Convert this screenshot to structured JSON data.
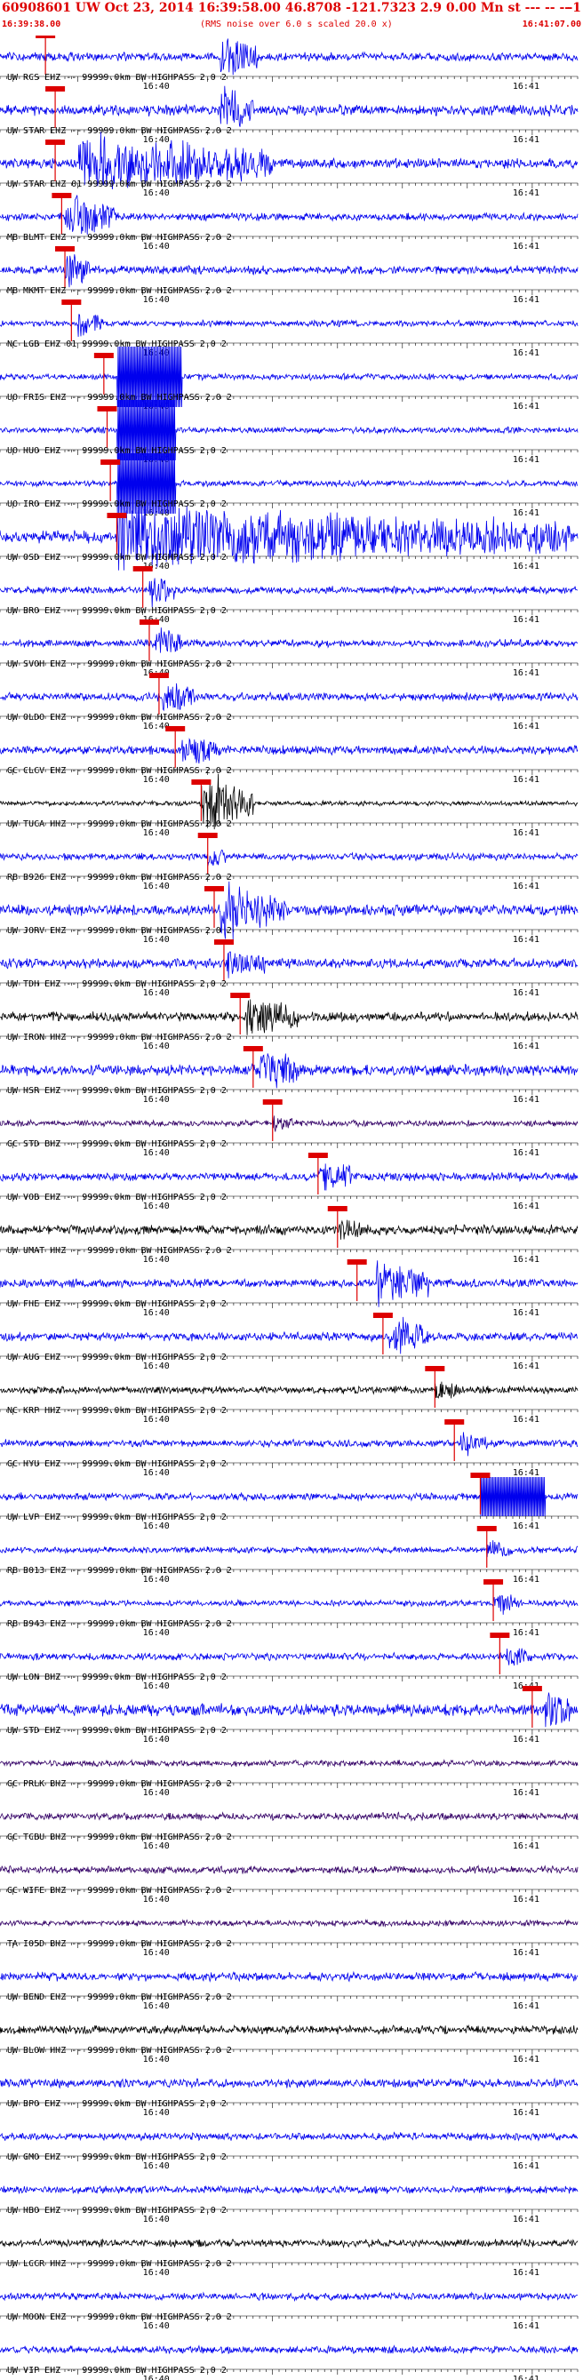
{
  "header": {
    "title": "60908601 UW Oct 23, 2014 16:39:58.00   46.8708 -121.7323  2.9 0.00 Mn st --- -- --",
    "title_tail": "-1",
    "start_time": "16:39:38.00",
    "end_time": "16:41:07.00",
    "note": "(RMS noise over 6.0 s scaled 20.0 x)"
  },
  "chart_data": {
    "type": "line",
    "title": "60908601 UW Oct 23, 2014 16:39:58.00   46.8708 -121.7323  2.9 0.00 Mn st --- -- --",
    "xlabel": "",
    "ylabel": "",
    "time_window": [
      "16:39:38.00",
      "16:41:07.00"
    ],
    "x_unit": "seconds after 16:39:38.00",
    "xlim": [
      0,
      89
    ],
    "minute_ticks": [
      {
        "t": 22,
        "label": "16:40"
      },
      {
        "t": 82,
        "label": "16:41"
      }
    ],
    "trace_label_suffix": " 99999.0km BW  HIGHPASS  2.0  2",
    "grid": false,
    "colors": {
      "header": "#dd0000",
      "pick": "#dd0000",
      "blue": "#0000ee",
      "black": "#000000",
      "purple": "#330066"
    },
    "series": [
      {
        "name": "UW RCS EHZ --",
        "color": "blue",
        "amp": 0.35,
        "pick": 7,
        "burst": [
          34,
          6,
          1.6
        ],
        "style": "normal"
      },
      {
        "name": "UW STAR EHZ --",
        "color": "blue",
        "amp": 0.45,
        "pick": 8.5,
        "burst": [
          34,
          5,
          1.6
        ],
        "style": "normal"
      },
      {
        "name": "UW STAR EHZ 01",
        "color": "blue",
        "amp": 0.4,
        "pick": 8.5,
        "burst": [
          12,
          30,
          2.2
        ],
        "style": "normal"
      },
      {
        "name": "MB BLMT EHZ --",
        "color": "blue",
        "amp": 0.3,
        "pick": 9.5,
        "burst": [
          10,
          8,
          1.8
        ],
        "style": "normal"
      },
      {
        "name": "MB MKMT EHZ --",
        "color": "blue",
        "amp": 0.35,
        "pick": 10,
        "burst": [
          10,
          4,
          1.4
        ],
        "style": "normal"
      },
      {
        "name": "NC LGB EHZ 01",
        "color": "blue",
        "amp": 0.25,
        "pick": 11,
        "burst": [
          12,
          4,
          1.0
        ],
        "style": "normal"
      },
      {
        "name": "UO FRIS EHZ --",
        "color": "blue",
        "amp": 0.25,
        "pick": 16,
        "burst": [
          18,
          10,
          3.5
        ],
        "style": "saturated"
      },
      {
        "name": "UO HUO EHZ --",
        "color": "blue",
        "amp": 0.25,
        "pick": 16.5,
        "burst": [
          18,
          9,
          3.5
        ],
        "style": "saturated"
      },
      {
        "name": "UO IRO EHZ --",
        "color": "blue",
        "amp": 0.25,
        "pick": 17,
        "burst": [
          18,
          9,
          3.5
        ],
        "style": "saturated"
      },
      {
        "name": "UW OSD EHZ --",
        "color": "blue",
        "amp": 0.5,
        "pick": 18,
        "burst": [
          18,
          70,
          2.2
        ],
        "style": "normal"
      },
      {
        "name": "UW BRO EHZ --",
        "color": "blue",
        "amp": 0.3,
        "pick": 22,
        "burst": [
          23,
          4,
          1.3
        ],
        "style": "normal"
      },
      {
        "name": "UW SVOH EHZ --",
        "color": "blue",
        "amp": 0.3,
        "pick": 23,
        "burst": [
          24,
          4,
          1.2
        ],
        "style": "normal"
      },
      {
        "name": "UW OLDO EHZ --",
        "color": "blue",
        "amp": 0.35,
        "pick": 24.5,
        "burst": [
          25,
          5,
          1.2
        ],
        "style": "normal"
      },
      {
        "name": "GC CLCV EHZ --",
        "color": "blue",
        "amp": 0.35,
        "pick": 27,
        "burst": [
          28,
          6,
          1.2
        ],
        "style": "normal"
      },
      {
        "name": "UW TUCA HHZ --",
        "color": "black",
        "amp": 0.2,
        "pick": 31,
        "burst": [
          31,
          8,
          2.6
        ],
        "style": "normal"
      },
      {
        "name": "RB B926 EHZ --",
        "color": "blue",
        "amp": 0.3,
        "pick": 32,
        "burst": [
          32,
          3,
          0.8
        ],
        "style": "normal"
      },
      {
        "name": "UW JORV EHZ --",
        "color": "blue",
        "amp": 0.45,
        "pick": 33,
        "burst": [
          34,
          10,
          2.0
        ],
        "style": "normal"
      },
      {
        "name": "UW TDH EHZ --",
        "color": "blue",
        "amp": 0.4,
        "pick": 34.5,
        "burst": [
          35,
          6,
          1.0
        ],
        "style": "normal"
      },
      {
        "name": "UW IRON HHZ --",
        "color": "black",
        "amp": 0.4,
        "pick": 37,
        "burst": [
          38,
          8,
          1.6
        ],
        "style": "normal"
      },
      {
        "name": "UW HSR EHZ --",
        "color": "blue",
        "amp": 0.45,
        "pick": 39,
        "burst": [
          40,
          6,
          1.6
        ],
        "style": "normal"
      },
      {
        "name": "GC STD BHZ --",
        "color": "purple",
        "amp": 0.25,
        "pick": 42,
        "burst": [
          42,
          3,
          0.5
        ],
        "style": "normal"
      },
      {
        "name": "UW VOB EHZ --",
        "color": "blue",
        "amp": 0.35,
        "pick": 49,
        "burst": [
          49,
          5,
          1.3
        ],
        "style": "normal"
      },
      {
        "name": "UW UMAT HHZ --",
        "color": "black",
        "amp": 0.4,
        "pick": 52,
        "burst": [
          52,
          4,
          0.8
        ],
        "style": "normal"
      },
      {
        "name": "UW FHE EHZ --",
        "color": "blue",
        "amp": 0.35,
        "pick": 55,
        "burst": [
          58,
          8,
          1.8
        ],
        "style": "normal"
      },
      {
        "name": "UW AUG EHZ --",
        "color": "blue",
        "amp": 0.35,
        "pick": 59,
        "burst": [
          60,
          6,
          1.6
        ],
        "style": "normal"
      },
      {
        "name": "NC KRP HHZ --",
        "color": "black",
        "amp": 0.3,
        "pick": 67,
        "burst": [
          67,
          4,
          0.6
        ],
        "style": "normal"
      },
      {
        "name": "GC HYU EHZ --",
        "color": "blue",
        "amp": 0.3,
        "pick": 70,
        "burst": [
          71,
          4,
          0.8
        ],
        "style": "normal"
      },
      {
        "name": "UW LVP EHZ --",
        "color": "blue",
        "amp": 0.3,
        "pick": 74,
        "burst": [
          74,
          10,
          3.5
        ],
        "style": "block"
      },
      {
        "name": "RB B013 EHZ --",
        "color": "blue",
        "amp": 0.25,
        "pick": 75,
        "burst": [
          75,
          4,
          0.8
        ],
        "style": "normal"
      },
      {
        "name": "RB B943 EHZ --",
        "color": "blue",
        "amp": 0.25,
        "pick": 76,
        "burst": [
          76,
          4,
          0.8
        ],
        "style": "normal"
      },
      {
        "name": "UW LON BHZ --",
        "color": "blue",
        "amp": 0.3,
        "pick": 77,
        "burst": [
          78,
          4,
          0.8
        ],
        "style": "normal"
      },
      {
        "name": "UW STD EHZ --",
        "color": "blue",
        "amp": 0.5,
        "pick": 82,
        "burst": [
          84,
          4,
          1.4
        ],
        "style": "normal"
      },
      {
        "name": "GC PRLK BHZ --",
        "color": "purple",
        "amp": 0.25,
        "pick": null,
        "burst": null,
        "style": "normal"
      },
      {
        "name": "GC TCBU BHZ --",
        "color": "purple",
        "amp": 0.3,
        "pick": null,
        "burst": null,
        "style": "normal"
      },
      {
        "name": "GC WIFE BHZ --",
        "color": "purple",
        "amp": 0.3,
        "pick": null,
        "burst": null,
        "style": "normal"
      },
      {
        "name": "TA I05D BHZ --",
        "color": "purple",
        "amp": 0.25,
        "pick": null,
        "burst": null,
        "style": "normal"
      },
      {
        "name": "UW BEND EHZ --",
        "color": "blue",
        "amp": 0.35,
        "pick": null,
        "burst": null,
        "style": "normal"
      },
      {
        "name": "UW BLOW HHZ --",
        "color": "black",
        "amp": 0.35,
        "pick": null,
        "burst": null,
        "style": "normal"
      },
      {
        "name": "UW BPO EHZ --",
        "color": "blue",
        "amp": 0.35,
        "pick": null,
        "burst": null,
        "style": "normal"
      },
      {
        "name": "UW GMO EHZ --",
        "color": "blue",
        "amp": 0.3,
        "pick": null,
        "burst": null,
        "style": "normal"
      },
      {
        "name": "UW HBO EHZ --",
        "color": "blue",
        "amp": 0.3,
        "pick": null,
        "burst": null,
        "style": "normal"
      },
      {
        "name": "UW LCCR HHZ --",
        "color": "black",
        "amp": 0.3,
        "pick": null,
        "burst": null,
        "style": "normal"
      },
      {
        "name": "UW MOON EHZ --",
        "color": "blue",
        "amp": 0.3,
        "pick": null,
        "burst": null,
        "style": "normal"
      },
      {
        "name": "UW VIP EHZ --",
        "color": "blue",
        "amp": 0.3,
        "pick": null,
        "burst": null,
        "style": "normal"
      }
    ]
  }
}
